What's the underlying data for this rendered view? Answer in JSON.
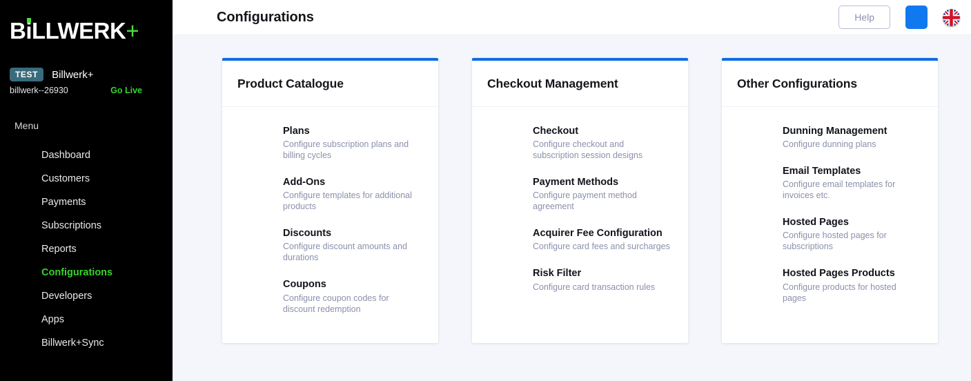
{
  "sidebar": {
    "logo": {
      "text_before_i": "B",
      "i": "i",
      "text_after_i": "LLWERK",
      "plus": "+"
    },
    "account": {
      "badge": "TEST",
      "name": "Billwerk+",
      "id": "billwerk--26930",
      "go_live": "Go Live"
    },
    "menu_label": "Menu",
    "items": [
      {
        "label": "Dashboard",
        "active": false
      },
      {
        "label": "Customers",
        "active": false
      },
      {
        "label": "Payments",
        "active": false
      },
      {
        "label": "Subscriptions",
        "active": false
      },
      {
        "label": "Reports",
        "active": false
      },
      {
        "label": "Configurations",
        "active": true
      },
      {
        "label": "Developers",
        "active": false
      },
      {
        "label": "Apps",
        "active": false
      },
      {
        "label": "Billwerk+Sync",
        "active": false
      }
    ]
  },
  "topbar": {
    "title": "Configurations",
    "help_label": "Help",
    "blue_button_icon": "blank-blue-square-icon",
    "flag_icon": "uk-flag-icon"
  },
  "colors": {
    "accent_blue": "#0d6ce4",
    "brand_green": "#35d42a",
    "sidebar_bg": "#000000",
    "page_bg": "#f4f6fb",
    "badge_teal": "#3a6b7c",
    "muted_text": "#8b90ab"
  },
  "cards": [
    {
      "title": "Product Catalogue",
      "items": [
        {
          "title": "Plans",
          "desc": "Configure subscription plans and billing cycles"
        },
        {
          "title": "Add-Ons",
          "desc": "Configure templates for additional products"
        },
        {
          "title": "Discounts",
          "desc": "Configure discount amounts and durations"
        },
        {
          "title": "Coupons",
          "desc": "Configure coupon codes for discount redemption"
        }
      ]
    },
    {
      "title": "Checkout Management",
      "items": [
        {
          "title": "Checkout",
          "desc": "Configure checkout and subscription session designs"
        },
        {
          "title": "Payment Methods",
          "desc": "Configure payment method agreement"
        },
        {
          "title": "Acquirer Fee Configuration",
          "desc": "Configure card fees and surcharges"
        },
        {
          "title": "Risk Filter",
          "desc": "Configure card transaction rules"
        }
      ]
    },
    {
      "title": "Other Configurations",
      "items": [
        {
          "title": "Dunning Management",
          "desc": "Configure dunning plans"
        },
        {
          "title": "Email Templates",
          "desc": "Configure email templates for invoices etc."
        },
        {
          "title": "Hosted Pages",
          "desc": "Configure hosted pages for subscriptions"
        },
        {
          "title": "Hosted Pages Products",
          "desc": "Configure products for hosted pages"
        }
      ]
    }
  ]
}
